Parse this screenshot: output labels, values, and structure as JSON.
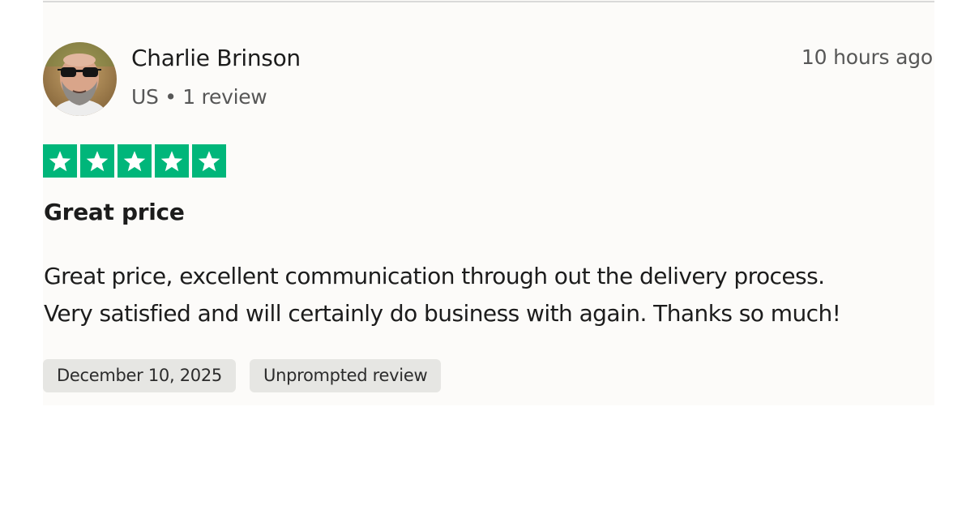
{
  "reviewer": {
    "name": "Charlie Brinson",
    "meta": "US • 1 review",
    "posted": "10 hours ago"
  },
  "rating": {
    "stars": 5,
    "max": 5,
    "color": "#00b67a"
  },
  "review": {
    "title": "Great price",
    "body_line1": "Great price, excellent communication through out the delivery process.",
    "body_line2": "Very satisfied and will certainly do business with again. Thanks so much!"
  },
  "tags": {
    "date": "December 10, 2025",
    "type": "Unprompted review"
  }
}
